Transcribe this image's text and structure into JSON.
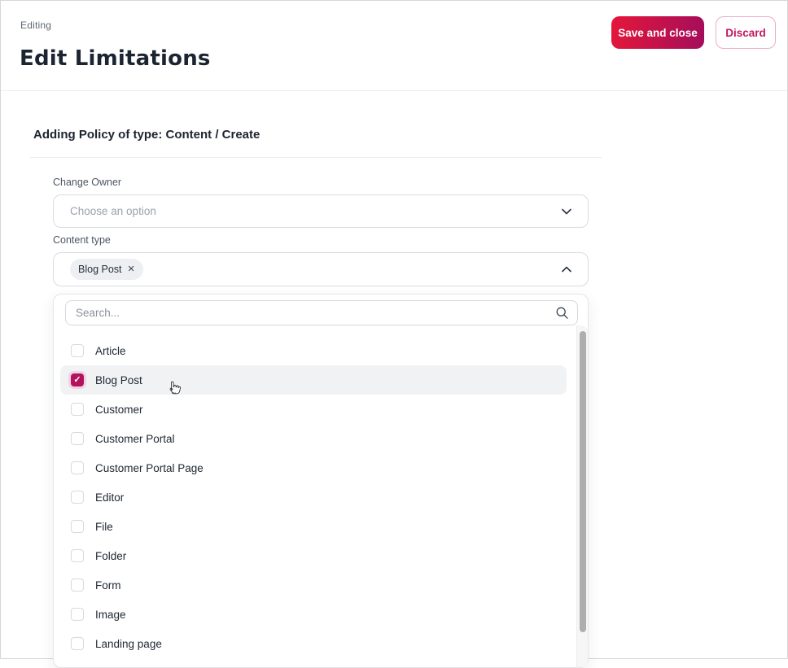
{
  "header": {
    "eyebrow": "Editing",
    "title": "Edit Limitations",
    "save_label": "Save and close",
    "discard_label": "Discard"
  },
  "form": {
    "section_title": "Adding Policy of type: Content / Create",
    "change_owner": {
      "label": "Change Owner",
      "placeholder": "Choose an option"
    },
    "content_type": {
      "label": "Content type",
      "chips": [
        {
          "label": "Blog Post",
          "remove_glyph": "✕"
        }
      ]
    }
  },
  "dropdown": {
    "search_placeholder": "Search...",
    "checkmark_glyph": "✓",
    "options": [
      {
        "label": "Article",
        "checked": false,
        "highlighted": false
      },
      {
        "label": "Blog Post",
        "checked": true,
        "highlighted": true
      },
      {
        "label": "Customer",
        "checked": false,
        "highlighted": false
      },
      {
        "label": "Customer Portal",
        "checked": false,
        "highlighted": false
      },
      {
        "label": "Customer Portal Page",
        "checked": false,
        "highlighted": false
      },
      {
        "label": "Editor",
        "checked": false,
        "highlighted": false
      },
      {
        "label": "File",
        "checked": false,
        "highlighted": false
      },
      {
        "label": "Folder",
        "checked": false,
        "highlighted": false
      },
      {
        "label": "Form",
        "checked": false,
        "highlighted": false
      },
      {
        "label": "Image",
        "checked": false,
        "highlighted": false
      },
      {
        "label": "Landing page",
        "checked": false,
        "highlighted": false
      }
    ]
  },
  "colors": {
    "accent_magenta": "#b3125c",
    "save_gradient_start": "#e5173a",
    "save_gradient_end": "#a30d5c",
    "discard_text": "#c2175f",
    "discard_border": "#ecadc9",
    "heading_text": "#1b2430",
    "row_highlight": "#f1f2f4",
    "checkbox_halo": "#f2d3e2"
  }
}
